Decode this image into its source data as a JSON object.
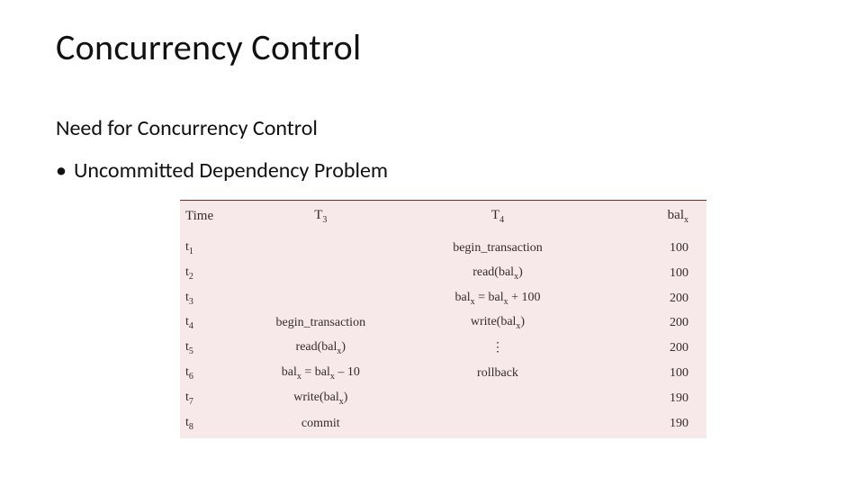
{
  "title": "Concurrency Control",
  "subtitle": "Need for Concurrency Control",
  "bullet": "Uncommitted Dependency Problem",
  "table": {
    "headers": {
      "time": "Time",
      "t3_html": "T<span class='sub'>3</span>",
      "t4_html": "T<span class='sub'>4</span>",
      "bal_html": "bal<span class='sub'>x</span>"
    },
    "rows": [
      {
        "time_html": "t<span class='sub'>1</span>",
        "t3_html": "",
        "t4_html": "begin_transaction",
        "bal": "100"
      },
      {
        "time_html": "t<span class='sub'>2</span>",
        "t3_html": "",
        "t4_html": "read(bal<span class='sub'>x</span>)",
        "bal": "100"
      },
      {
        "time_html": "t<span class='sub'>3</span>",
        "t3_html": "",
        "t4_html": "bal<span class='sub'>x</span> = bal<span class='sub'>x</span> + 100",
        "bal": "200"
      },
      {
        "time_html": "t<span class='sub'>4</span>",
        "t3_html": "begin_transaction",
        "t4_html": "write(bal<span class='sub'>x</span>)",
        "bal": "200"
      },
      {
        "time_html": "t<span class='sub'>5</span>",
        "t3_html": "read(bal<span class='sub'>x</span>)",
        "t4_html": "⋮",
        "bal": "200"
      },
      {
        "time_html": "t<span class='sub'>6</span>",
        "t3_html": "bal<span class='sub'>x</span> = bal<span class='sub'>x</span> – 10",
        "t4_html": "rollback",
        "bal": "100"
      },
      {
        "time_html": "t<span class='sub'>7</span>",
        "t3_html": "write(bal<span class='sub'>x</span>)",
        "t4_html": "",
        "bal": "190"
      },
      {
        "time_html": "t<span class='sub'>8</span>",
        "t3_html": "commit",
        "t4_html": "",
        "bal": "190"
      }
    ]
  }
}
